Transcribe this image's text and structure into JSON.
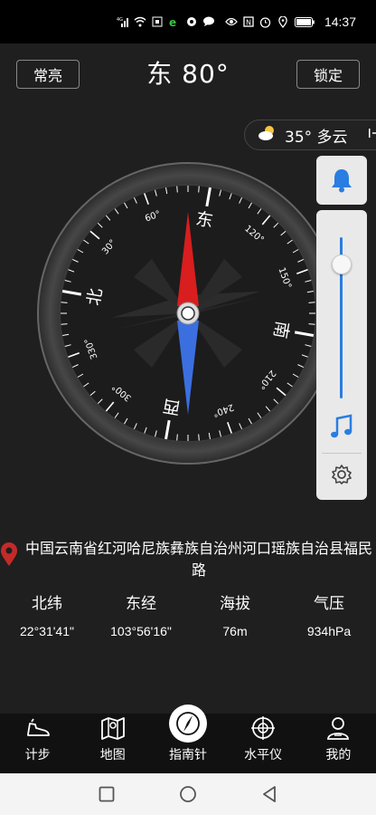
{
  "status_bar": {
    "network": "4G",
    "time": "14:37"
  },
  "header": {
    "keep_on_label": "常亮",
    "heading_text": "东 80°",
    "lock_label": "锁定"
  },
  "weather": {
    "text": "35° 多云",
    "expand_icon": "chevron-right-bar-icon"
  },
  "compass": {
    "heading_deg": 80,
    "cardinals": [
      "北",
      "东",
      "南",
      "西"
    ],
    "degree_marks": [
      "30°",
      "60°",
      "120°",
      "150°",
      "210°",
      "240°",
      "300°",
      "330°"
    ],
    "needle_north_color": "#d81e1e",
    "needle_south_color": "#3b6fe0"
  },
  "side_panel": {
    "bell_icon": "bell-icon",
    "volume_level": 0.92,
    "music_icon": "music-note-icon",
    "settings_icon": "gear-icon",
    "accent_color": "#2a7de1"
  },
  "location": {
    "address": "中国云南省红河哈尼族彝族自治州河口瑶族自治县福民路"
  },
  "stats": [
    {
      "label": "北纬",
      "value": "22°31'41\""
    },
    {
      "label": "东经",
      "value": "103°56'16\""
    },
    {
      "label": "海拔",
      "value": "76m"
    },
    {
      "label": "气压",
      "value": "934hPa"
    }
  ],
  "tabs": [
    {
      "label": "计步",
      "icon": "shoe-icon"
    },
    {
      "label": "地图",
      "icon": "map-icon"
    },
    {
      "label": "指南针",
      "icon": "compass-icon"
    },
    {
      "label": "水平仪",
      "icon": "level-icon"
    },
    {
      "label": "我的",
      "icon": "user-icon"
    }
  ]
}
